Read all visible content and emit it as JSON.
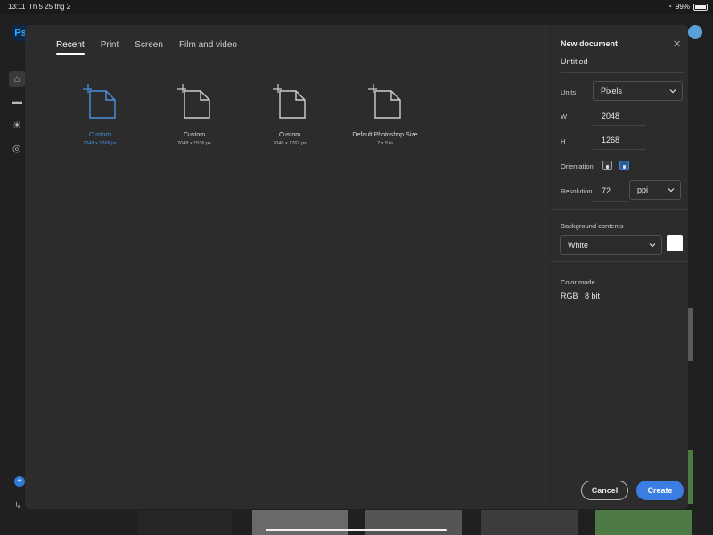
{
  "status_bar": {
    "time": "13:11",
    "date": "Th 5 25 thg 2",
    "battery": "99%"
  },
  "app": {
    "logo": "Ps"
  },
  "tabs": [
    {
      "label": "Recent",
      "active": true
    },
    {
      "label": "Print",
      "active": false
    },
    {
      "label": "Screen",
      "active": false
    },
    {
      "label": "Film and video",
      "active": false
    }
  ],
  "presets": [
    {
      "name": "Custom",
      "size": "2048 x 1268 px",
      "selected": true
    },
    {
      "name": "Custom",
      "size": "2048 x 1536 px",
      "selected": false
    },
    {
      "name": "Custom",
      "size": "2048 x 1762 px",
      "selected": false
    },
    {
      "name": "Default Photoshop Size",
      "size": "7 x 5 in",
      "selected": false
    }
  ],
  "panel": {
    "title": "New document",
    "doc_name": "Untitled",
    "units_label": "Units",
    "units_value": "Pixels",
    "width_label": "W",
    "width_value": "2048",
    "height_label": "H",
    "height_value": "1268",
    "orientation_label": "Orientation",
    "orientation_selected": "landscape",
    "resolution_label": "Resolution",
    "resolution_value": "72",
    "resolution_unit": "ppi",
    "background_label": "Background contents",
    "background_value": "White",
    "background_color": "#ffffff",
    "color_mode_label": "Color mode",
    "color_mode_value": "RGB",
    "bit_depth_value": "8 bit",
    "cancel_label": "Cancel",
    "create_label": "Create"
  },
  "colors": {
    "accent": "#3a7ee3",
    "modal_bg": "#2c2c2c",
    "selected_preset": "#4d8fe0"
  }
}
